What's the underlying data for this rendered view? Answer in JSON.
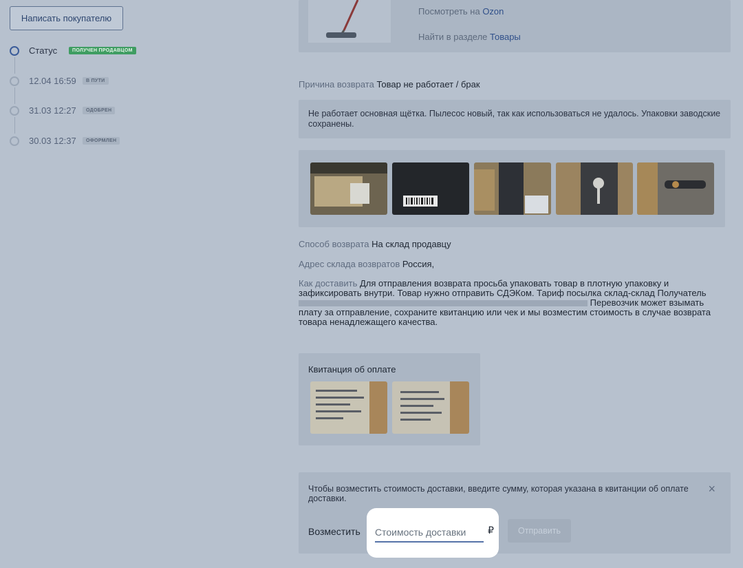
{
  "left": {
    "write_button": "Написать покупателю",
    "timeline": [
      {
        "label": "Статус",
        "badge": "ПОЛУЧЕН ПРОДАВЦОМ",
        "active": true
      },
      {
        "label": "12.04 16:59",
        "badge": "В ПУТИ",
        "active": false
      },
      {
        "label": "31.03 12:27",
        "badge": "ОДОБРЕН",
        "active": false
      },
      {
        "label": "30.03 12:37",
        "badge": "ОФОРМЛЕН",
        "active": false
      }
    ]
  },
  "product": {
    "view_prefix": "Посмотреть на",
    "view_link": "Ozon",
    "find_prefix": "Найти в разделе",
    "find_link": "Товары"
  },
  "reason": {
    "label": "Причина возврата",
    "value": "Товар не работает / брак",
    "comment": "Не работает основная щётка. Пылесос новый, так как использоваться не удалось. Упаковки заводские сохранены."
  },
  "return_method": {
    "label": "Способ возврата",
    "value": "На склад продавцу"
  },
  "warehouse": {
    "label": "Адрес склада возвратов",
    "value": "Россия,"
  },
  "delivery": {
    "label": "Как доставить",
    "text1": "Для отправления возврата просьба упаковать товар в плотную упаковку и зафиксировать внутри. Товар нужно отправить СДЭКом. Тариф посылка склад-склад",
    "text2": "Получатель",
    "text3": "Перевозчик может взымать плату за отправление, сохраните квитанцию или чек и мы возместим стоимость в случае возврата товара ненадлежащего качества."
  },
  "receipt": {
    "title": "Квитанция об оплате"
  },
  "compensation": {
    "info": "Чтобы возместить стоимость доставки, введите сумму, которая указана в квитанции об оплате доставки.",
    "label": "Возместить",
    "placeholder": "Стоимость доставки",
    "currency": "₽",
    "send_label": "Отправить",
    "close_icon": "×"
  }
}
